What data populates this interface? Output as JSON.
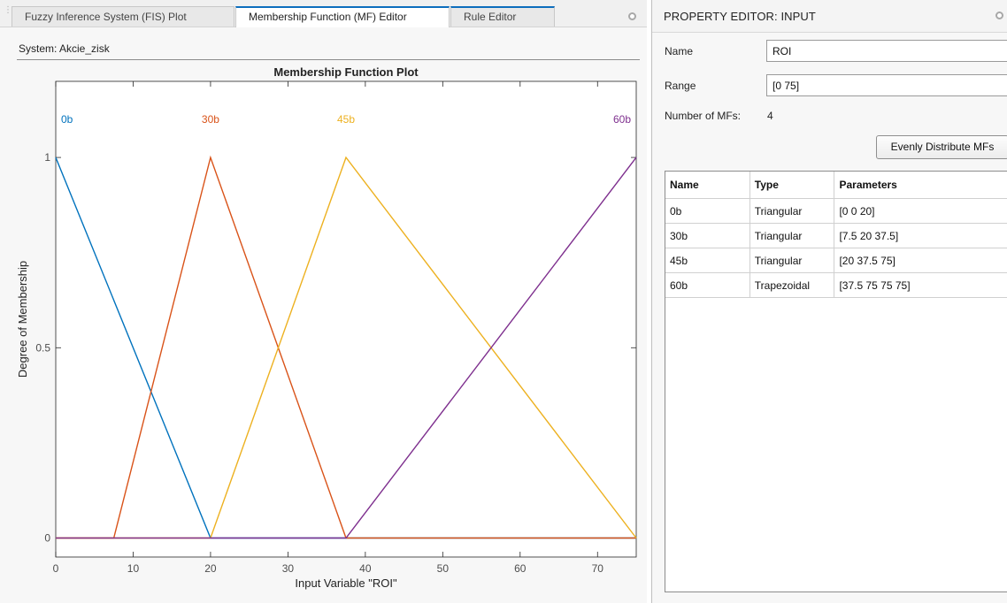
{
  "tabs": [
    {
      "label": "Fuzzy Inference System (FIS) Plot"
    },
    {
      "label": "Membership Function (MF) Editor"
    },
    {
      "label": "Rule Editor"
    }
  ],
  "system": {
    "label": "System: Akcie_zisk"
  },
  "property_editor": {
    "title": "PROPERTY EDITOR: INPUT",
    "name_label": "Name",
    "name_value": "ROI",
    "range_label": "Range",
    "range_value": "[0 75]",
    "num_mfs_label": "Number of MFs:",
    "num_mfs_value": "4",
    "evenly_button": "Evenly Distribute MFs",
    "table": {
      "headers": [
        "Name",
        "Type",
        "Parameters"
      ],
      "rows": [
        [
          "0b",
          "Triangular",
          "[0 0 20]"
        ],
        [
          "30b",
          "Triangular",
          "[7.5 20 37.5]"
        ],
        [
          "45b",
          "Triangular",
          "[20 37.5 75]"
        ],
        [
          "60b",
          "Trapezoidal",
          "[37.5 75 75 75]"
        ]
      ]
    }
  },
  "chart_data": {
    "type": "line",
    "title": "Membership Function Plot",
    "xlabel": "Input Variable \"ROI\"",
    "ylabel": "Degree of Membership",
    "xlim": [
      0,
      75
    ],
    "ylim": [
      -0.05,
      1.2
    ],
    "xticks": [
      0,
      10,
      20,
      30,
      40,
      50,
      60,
      70
    ],
    "yticks": [
      0,
      0.5,
      1
    ],
    "grid": false,
    "series": [
      {
        "name": "0b",
        "color": "#0072bd",
        "x": [
          0,
          0,
          20,
          75
        ],
        "y": [
          1,
          1,
          0,
          0
        ]
      },
      {
        "name": "30b",
        "color": "#d95319",
        "x": [
          0,
          7.5,
          20,
          37.5,
          75
        ],
        "y": [
          0,
          0,
          1,
          0,
          0
        ]
      },
      {
        "name": "45b",
        "color": "#edb120",
        "x": [
          0,
          20,
          37.5,
          75
        ],
        "y": [
          0,
          0,
          1,
          0
        ]
      },
      {
        "name": "60b",
        "color": "#7e2f8e",
        "x": [
          0,
          37.5,
          75,
          75
        ],
        "y": [
          0,
          0,
          1,
          1
        ]
      }
    ],
    "mf_labels": [
      {
        "text": "0b",
        "x": 0,
        "color": "#0072bd"
      },
      {
        "text": "30b",
        "x": 20,
        "color": "#d95319"
      },
      {
        "text": "45b",
        "x": 37.5,
        "color": "#edb120"
      },
      {
        "text": "60b",
        "x": 75,
        "color": "#7e2f8e"
      }
    ]
  }
}
